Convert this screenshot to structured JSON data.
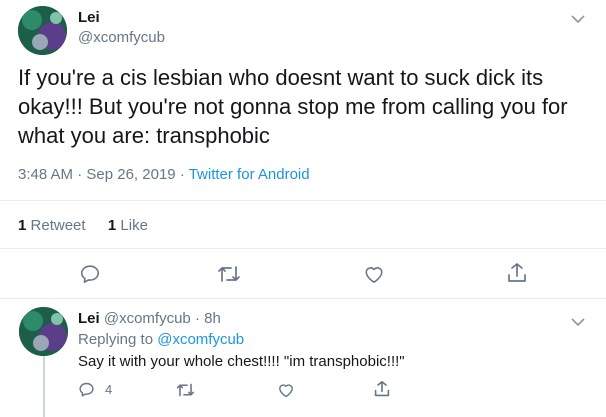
{
  "tweet": {
    "author_name": "Lei",
    "author_handle": "@xcomfycub",
    "text": "If you're a cis lesbian who doesnt want to suck dick its okay!!! But you're not gonna stop me from calling you for what you are: transphobic",
    "time": "3:48 AM",
    "separator": "·",
    "date": "Sep 26, 2019",
    "source": "Twitter for Android",
    "retweet_count": "1",
    "retweet_label": "Retweet",
    "like_count": "1",
    "like_label": "Like"
  },
  "reply": {
    "author_name": "Lei",
    "author_handle": "@xcomfycub",
    "separator": "·",
    "age": "8h",
    "replying_prefix": "Replying to",
    "replying_to": "@xcomfycub",
    "text": "Say it with your whole chest!!!! \"im transphobic!!!\"",
    "reply_count": "4"
  },
  "icons": [
    "chevron-down-icon",
    "reply-icon",
    "retweet-icon",
    "like-icon",
    "share-icon"
  ],
  "colors": {
    "link": "#1b95e0",
    "secondary": "#657786",
    "divider": "#e6ecf0",
    "text": "#14171a"
  }
}
